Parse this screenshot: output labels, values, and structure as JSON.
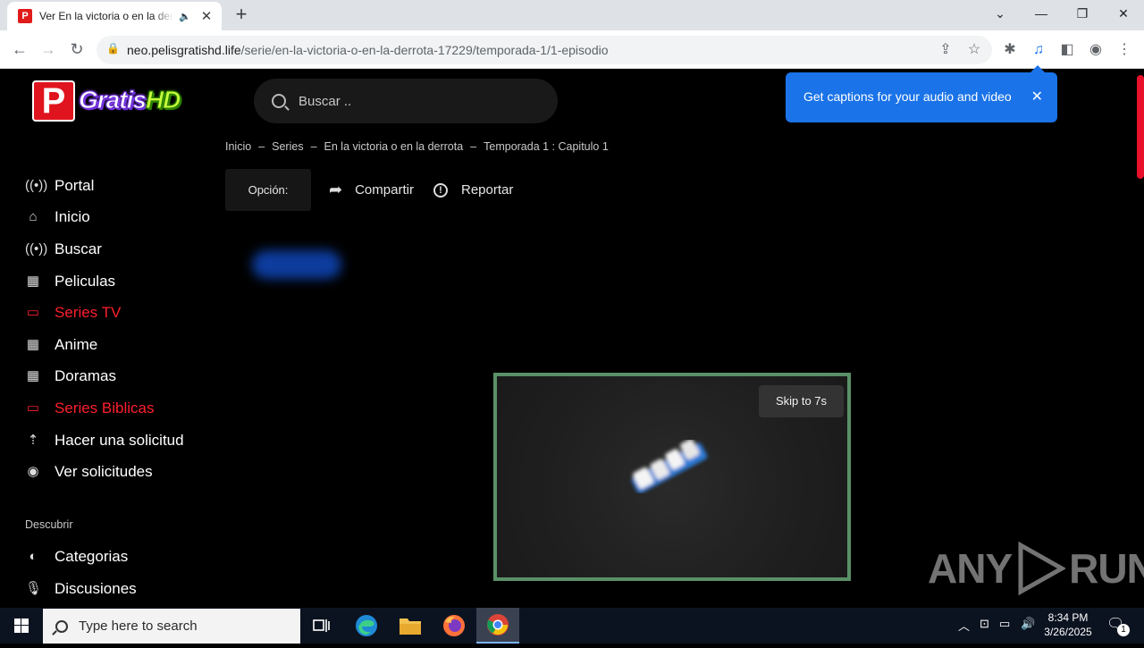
{
  "browser": {
    "tab_title": "Ver En la victoria o en la derrota",
    "tab_favicon_letter": "P",
    "url_host": "neo.pelisgratishd.life",
    "url_path": "/serie/en-la-victoria-o-en-la-derrota-17229/temporada-1/1-episodio",
    "caption_tooltip": "Get captions for your audio and video"
  },
  "site": {
    "logo_letter": "P",
    "logo_text_1": "Gratis",
    "logo_text_2": "HD",
    "search_placeholder": "Buscar ..",
    "breadcrumb": [
      "Inicio",
      "Series",
      "En la victoria o en la derrota",
      "Temporada 1 : Capitulo 1"
    ],
    "breadcrumb_sep": "–",
    "option_label": "Opción:",
    "share_label": "Compartir",
    "report_label": "Reportar"
  },
  "sidebar": {
    "items": [
      {
        "label": "Portal",
        "icon": "broadcast-icon",
        "active": false
      },
      {
        "label": "Inicio",
        "icon": "home-icon",
        "active": false
      },
      {
        "label": "Buscar",
        "icon": "broadcast-icon",
        "active": false
      },
      {
        "label": "Peliculas",
        "icon": "film-icon",
        "active": false
      },
      {
        "label": "Series TV",
        "icon": "tv-icon",
        "active": true
      },
      {
        "label": "Anime",
        "icon": "film-icon",
        "active": false
      },
      {
        "label": "Doramas",
        "icon": "film-icon",
        "active": false
      },
      {
        "label": "Series Biblicas",
        "icon": "tv-icon",
        "active": true
      },
      {
        "label": "Hacer una solicitud",
        "icon": "upload-icon",
        "active": false
      },
      {
        "label": "Ver solicitudes",
        "icon": "eye-icon",
        "active": false
      }
    ],
    "section_label": "Descubrir",
    "discover_items": [
      {
        "label": "Categorias",
        "icon": "half-circle-icon"
      },
      {
        "label": "Discusiones",
        "icon": "microphone-icon"
      }
    ]
  },
  "ad": {
    "skip_label": "Skip to 7s"
  },
  "watermark": {
    "left": "ANY",
    "right": "RUN"
  },
  "taskbar": {
    "search_placeholder": "Type here to search",
    "time": "8:34 PM",
    "date": "3/26/2025",
    "notification_count": "1"
  },
  "colors": {
    "accent_red": "#ff1f2d",
    "tooltip_blue": "#1a73e8",
    "ad_border": "#5a9068"
  }
}
